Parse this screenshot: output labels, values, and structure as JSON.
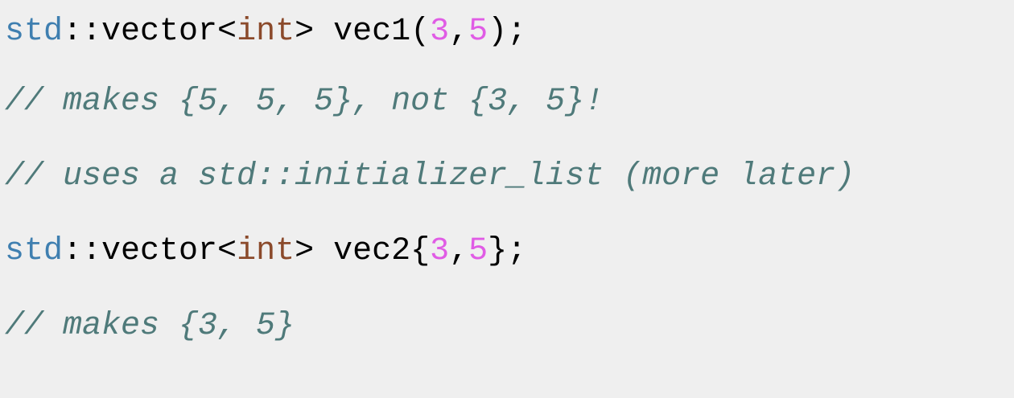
{
  "code": {
    "line1": {
      "ns": "std",
      "scope": "::vector<",
      "type": "int",
      "decl": "> vec1(",
      "num_a": "3",
      "sep": ",",
      "num_b": "5",
      "end": ");"
    },
    "line2": {
      "comment": "// makes {5, 5, 5}, not {3, 5}!"
    },
    "line3": {
      "comment": "// uses a std::initializer_list (more later)"
    },
    "line4": {
      "ns": "std",
      "scope": "::vector<",
      "type": "int",
      "decl": "> vec2{",
      "num_a": "3",
      "sep": ",",
      "num_b": "5",
      "end": "};"
    },
    "line5": {
      "comment": "// makes {3, 5}"
    }
  },
  "colors": {
    "background": "#efefef",
    "namespace": "#3f7fb0",
    "type_keyword": "#8b4a2b",
    "number_literal": "#e05ce5",
    "comment": "#4f7a7a",
    "plain": "#000000"
  }
}
